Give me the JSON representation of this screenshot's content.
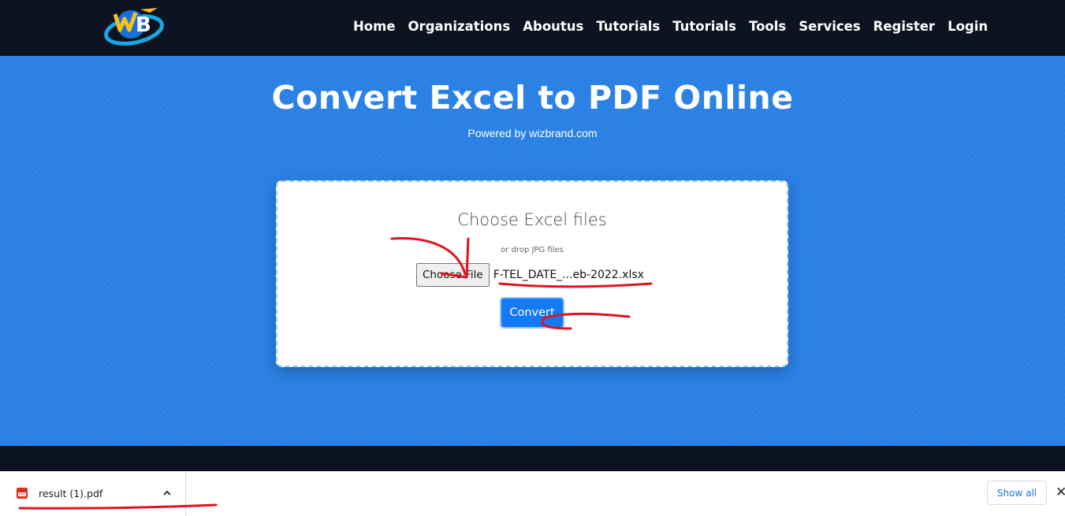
{
  "nav": {
    "logo_text": "WB",
    "links": [
      "Home",
      "Organizations",
      "Aboutus",
      "Tutorials",
      "Tutorials",
      "Tools",
      "Services",
      "Register",
      "Login"
    ]
  },
  "hero": {
    "title": "Convert Excel to PDF Online",
    "subtitle": "Powered by wizbrand.com"
  },
  "upload": {
    "title": "Choose Excel files",
    "hint": "or drop JPG files",
    "choose_label": "Choose File",
    "file_name": "F-TEL_DATE_...eb-2022.xlsx",
    "convert_label": "Convert"
  },
  "downloads": {
    "file_name": "result (1).pdf",
    "file_icon": "pdf-file-icon",
    "show_all_label": "Show all",
    "close_symbol": "✕"
  },
  "colors": {
    "navbar": "#0d1321",
    "hero": "#2a7fe3",
    "convert_button": "#1479f5",
    "annotation": "#e0141e",
    "show_all_text": "#1a73e8"
  }
}
